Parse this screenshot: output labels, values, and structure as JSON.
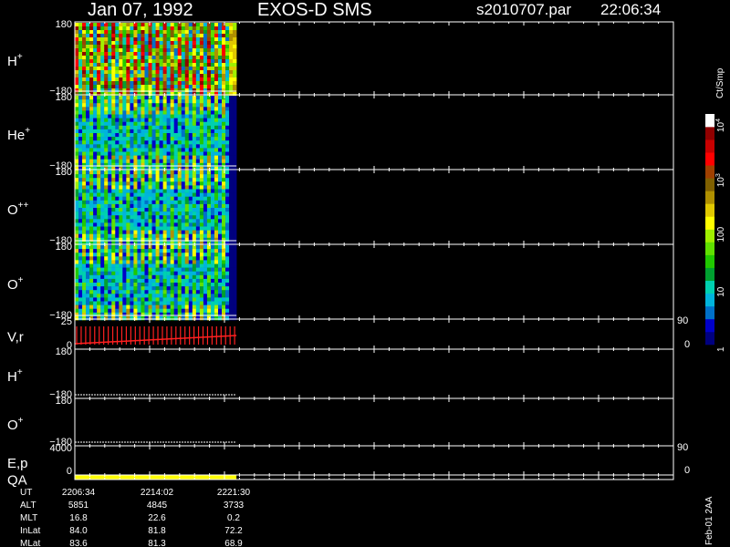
{
  "header": {
    "date": "Jan 07, 1992",
    "mission": "EXOS-D SMS",
    "file": "s2010707.par",
    "time": "22:06:34"
  },
  "colorbar": {
    "unit": "Ct/Smp",
    "ticks": [
      {
        "label": "1",
        "value": 1
      },
      {
        "label": "10",
        "value": 10
      },
      {
        "label": "100",
        "value": 100
      },
      {
        "label": "10",
        "sup": "3",
        "value": 1000
      },
      {
        "label": "10",
        "sup": "4",
        "value": 10000
      }
    ],
    "colors": [
      "#00007f",
      "#0000c8",
      "#0070c8",
      "#00b4dc",
      "#00d0b0",
      "#00a030",
      "#20c800",
      "#60e000",
      "#a0f000",
      "#ffff00",
      "#e0c800",
      "#b09000",
      "#806000",
      "#a04000",
      "#ff0000",
      "#c80000",
      "#900000",
      "#ffffff"
    ]
  },
  "panels": [
    {
      "id": "h-plus",
      "label": "H",
      "sup": "+",
      "ymax": "180",
      "ymin": "−180"
    },
    {
      "id": "he-plus",
      "label": "He",
      "sup": "+",
      "ymax": "180",
      "ymin": "−180"
    },
    {
      "id": "o-plusplus",
      "label": "O",
      "sup": "++",
      "ymax": "180",
      "ymin": "−180"
    },
    {
      "id": "o-plus",
      "label": "O",
      "sup": "+",
      "ymax": "180",
      "ymin": "−180"
    },
    {
      "id": "vr",
      "label": "V,r",
      "ymax": "25",
      "ymin": "0",
      "rmax": "90",
      "rmin": "0"
    },
    {
      "id": "h-plus-2",
      "label": "H",
      "sup": "+",
      "ymax": "180",
      "ymin": "−180"
    },
    {
      "id": "o-plus-2",
      "label": "O",
      "sup": "+",
      "ymax": "180",
      "ymin": "−180"
    },
    {
      "id": "ep",
      "label": "E,p",
      "ymax": "4000",
      "ymin": "0",
      "rmax": "90",
      "rmin": "0"
    },
    {
      "id": "qa",
      "label": "QA"
    }
  ],
  "ephemeris": {
    "rows": [
      {
        "label": "UT",
        "values": [
          "2206:34",
          "2214:02",
          "2221:30"
        ]
      },
      {
        "label": "ALT",
        "values": [
          "5851",
          "4845",
          "3733"
        ]
      },
      {
        "label": "MLT",
        "values": [
          "16.8",
          "22.6",
          "0.2"
        ]
      },
      {
        "label": "InLat",
        "values": [
          "84.0",
          "81.8",
          "72.2"
        ]
      },
      {
        "label": "MLat",
        "values": [
          "83.6",
          "81.3",
          "68.9"
        ]
      }
    ]
  },
  "footer_code": "Feb-01 2AA",
  "chart_data": {
    "type": "heatmap",
    "series": [
      {
        "name": "H+",
        "pattern": "dense"
      },
      {
        "name": "He+",
        "pattern": "patchy"
      },
      {
        "name": "O++",
        "pattern": "patchy"
      },
      {
        "name": "O+",
        "pattern": "patchy"
      }
    ],
    "ylim": [
      -180,
      180
    ],
    "data_extent_fraction": 0.27,
    "colorbar_range": [
      1,
      10000
    ],
    "color_scale": "log"
  }
}
